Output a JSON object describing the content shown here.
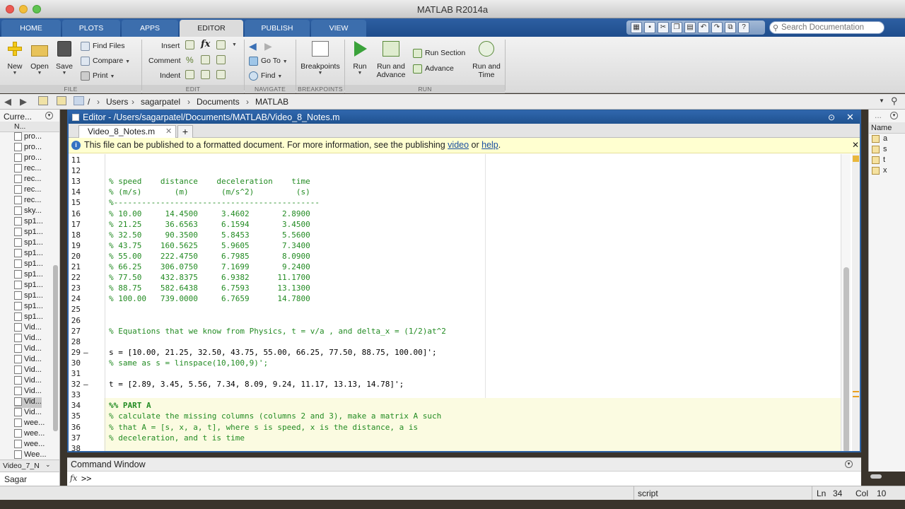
{
  "window": {
    "title": "MATLAB R2014a"
  },
  "ribbon_tabs": [
    "HOME",
    "PLOTS",
    "APPS",
    "EDITOR",
    "PUBLISH",
    "VIEW"
  ],
  "search": {
    "placeholder": "Search Documentation"
  },
  "toolstrip": {
    "file": {
      "label": "FILE",
      "new": "New",
      "open": "Open",
      "save": "Save",
      "find_files": "Find Files",
      "compare": "Compare",
      "print": "Print"
    },
    "edit": {
      "label": "EDIT",
      "insert": "Insert",
      "comment": "Comment",
      "indent": "Indent"
    },
    "navigate": {
      "label": "NAVIGATE",
      "go_to": "Go To",
      "find": "Find"
    },
    "breakpoints": {
      "label": "BREAKPOINTS",
      "button": "Breakpoints"
    },
    "run": {
      "label": "RUN",
      "run": "Run",
      "run_and_advance": [
        "Run and",
        "Advance"
      ],
      "run_section": "Run Section",
      "advance": "Advance",
      "run_and_time": [
        "Run and",
        "Time"
      ]
    }
  },
  "address": {
    "root": "/",
    "parts": [
      "Users",
      "sagarpatel",
      "Documents",
      "MATLAB"
    ]
  },
  "current_folder": {
    "title": "Curre...",
    "header": "N...",
    "files": [
      "pro...",
      "pro...",
      "pro...",
      "rec...",
      "rec...",
      "rec...",
      "rec...",
      "sky...",
      "sp1...",
      "sp1...",
      "sp1...",
      "sp1...",
      "sp1...",
      "sp1...",
      "sp1...",
      "sp1...",
      "sp1...",
      "sp1...",
      "Vid...",
      "Vid...",
      "Vid...",
      "Vid...",
      "Vid...",
      "Vid...",
      "Vid...",
      "Vid...",
      "Vid...",
      "wee...",
      "wee...",
      "wee...",
      "Wee..."
    ],
    "footer_file": "Video_7_N",
    "details": "Sagar"
  },
  "editor": {
    "title": "Editor - /Users/sagarpatel/Documents/MATLAB/Video_8_Notes.m",
    "tab": "Video_8_Notes.m",
    "info": {
      "text": "This file can be published to a formatted document. For more information, see the publishing ",
      "link1": "video",
      "or": " or ",
      "link2": "help",
      "end": "."
    },
    "lines": [
      {
        "n": "11",
        "code": "",
        "kind": "code",
        "dash": false
      },
      {
        "n": "12",
        "code": "",
        "kind": "code",
        "dash": false
      },
      {
        "n": "13",
        "code": "% speed    distance    deceleration    time",
        "kind": "comment",
        "dash": false
      },
      {
        "n": "14",
        "code": "% (m/s)       (m)       (m/s^2)         (s)",
        "kind": "comment",
        "dash": false
      },
      {
        "n": "15",
        "code": "%--------------------------------------------",
        "kind": "comment",
        "dash": false
      },
      {
        "n": "16",
        "code": "% 10.00     14.4500     3.4602       2.8900",
        "kind": "comment",
        "dash": false
      },
      {
        "n": "17",
        "code": "% 21.25     36.6563     6.1594       3.4500",
        "kind": "comment",
        "dash": false
      },
      {
        "n": "18",
        "code": "% 32.50     90.3500     5.8453       5.5600",
        "kind": "comment",
        "dash": false
      },
      {
        "n": "19",
        "code": "% 43.75    160.5625     5.9605       7.3400",
        "kind": "comment",
        "dash": false
      },
      {
        "n": "20",
        "code": "% 55.00    222.4750     6.7985       8.0900",
        "kind": "comment",
        "dash": false
      },
      {
        "n": "21",
        "code": "% 66.25    306.0750     7.1699       9.2400",
        "kind": "comment",
        "dash": false
      },
      {
        "n": "22",
        "code": "% 77.50    432.8375     6.9382      11.1700",
        "kind": "comment",
        "dash": false
      },
      {
        "n": "23",
        "code": "% 88.75    582.6438     6.7593      13.1300",
        "kind": "comment",
        "dash": false
      },
      {
        "n": "24",
        "code": "% 100.00   739.0000     6.7659      14.7800",
        "kind": "comment",
        "dash": false
      },
      {
        "n": "25",
        "code": "",
        "kind": "code",
        "dash": false
      },
      {
        "n": "26",
        "code": "",
        "kind": "code",
        "dash": false
      },
      {
        "n": "27",
        "code": "% Equations that we know from Physics, t = v/a , and delta_x = (1/2)at^2",
        "kind": "comment",
        "dash": false
      },
      {
        "n": "28",
        "code": "",
        "kind": "code",
        "dash": false
      },
      {
        "n": "29",
        "code": "s = [10.00, 21.25, 32.50, 43.75, 55.00, 66.25, 77.50, 88.75, 100.00]';",
        "kind": "code",
        "dash": true
      },
      {
        "n": "30",
        "code": "% same as s = linspace(10,100,9)';",
        "kind": "comment",
        "dash": false
      },
      {
        "n": "31",
        "code": "",
        "kind": "code",
        "dash": false
      },
      {
        "n": "32",
        "code": "t = [2.89, 3.45, 5.56, 7.34, 8.09, 9.24, 11.17, 13.13, 14.78]';",
        "kind": "code",
        "dash": true
      },
      {
        "n": "33",
        "code": "",
        "kind": "code",
        "dash": false
      },
      {
        "n": "34",
        "code": "%% PART A",
        "kind": "cell",
        "dash": false
      },
      {
        "n": "35",
        "code": "% calculate the missing columns (columns 2 and 3), make a matrix A such",
        "kind": "comment",
        "dash": false
      },
      {
        "n": "36",
        "code": "% that A = [s, x, a, t], where s is speed, x is the distance, a is",
        "kind": "comment",
        "dash": false
      },
      {
        "n": "37",
        "code": "% deceleration, and t is time",
        "kind": "comment",
        "dash": false
      },
      {
        "n": "38",
        "code": "",
        "kind": "code",
        "dash": false
      }
    ]
  },
  "workspace": {
    "header": "Name",
    "vars": [
      "a",
      "s",
      "t",
      "x"
    ]
  },
  "command_window": {
    "title": "Command Window",
    "prompt": ">>",
    "fx": "fx"
  },
  "status": {
    "mode": "script",
    "ln_label": "Ln",
    "ln": "34",
    "col_label": "Col",
    "col": "10"
  },
  "colors": {
    "ribbon_blue": "#2559a0",
    "comment_green": "#228b22",
    "info_yellow": "#ffffd0",
    "cell_yellow": "#fbfbe1"
  }
}
